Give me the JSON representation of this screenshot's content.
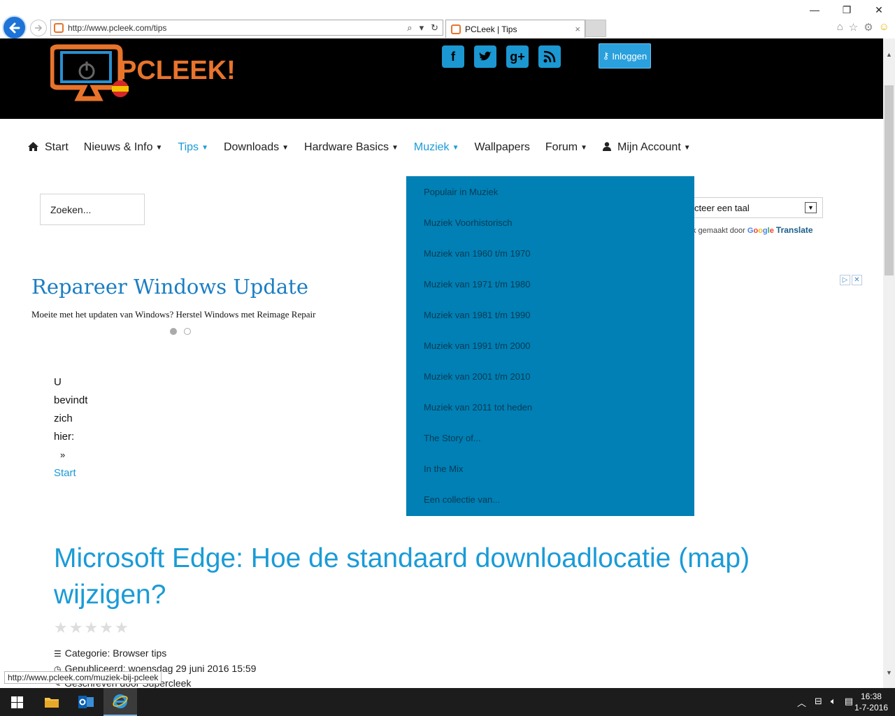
{
  "browser": {
    "address_url": "http://www.pcleek.com/tips",
    "tab_title": "PCLeek | Tips",
    "tab_close": "×",
    "status_url": "http://www.pcleek.com/muziek-bij-pcleek",
    "window_controls": {
      "minimize": "—",
      "restore": "❐",
      "close": "✕"
    },
    "toolbar_icons": {
      "home": "⌂",
      "favorites": "☆",
      "settings": "⚙",
      "feedback": "☺"
    }
  },
  "header": {
    "logo_text": "PCLEEK!",
    "login_label": "Inloggen",
    "social_icons": [
      "facebook-icon",
      "twitter-icon",
      "googleplus-icon",
      "rss-icon"
    ]
  },
  "nav": {
    "items": [
      {
        "label": "Start",
        "icon": "home-icon",
        "active": false,
        "has_menu": false
      },
      {
        "label": "Nieuws & Info",
        "active": false,
        "has_menu": true
      },
      {
        "label": "Tips",
        "active": true,
        "has_menu": true
      },
      {
        "label": "Downloads",
        "active": false,
        "has_menu": true
      },
      {
        "label": "Hardware Basics",
        "active": false,
        "has_menu": true
      },
      {
        "label": "Muziek",
        "active": true,
        "has_menu": true
      },
      {
        "label": "Wallpapers",
        "active": false,
        "has_menu": false
      },
      {
        "label": "Forum",
        "active": false,
        "has_menu": true
      },
      {
        "label": "Mijn Account",
        "icon": "user-icon",
        "active": false,
        "has_menu": true
      }
    ]
  },
  "search": {
    "placeholder": "Zoeken..."
  },
  "translate": {
    "select_label": "cteer een taal",
    "credit_prefix": "k gemaakt door",
    "credit_brand": "Google",
    "credit_link": "Translate"
  },
  "ad": {
    "title": "Repareer Windows Update",
    "text": "Moeite met het updaten van Windows? Herstel Windows met Reimage Repair",
    "choices": [
      "▷",
      "✕"
    ]
  },
  "breadcrumb": {
    "words": [
      "U",
      "bevindt",
      "zich",
      "hier:"
    ],
    "separator": "»",
    "link": "Start"
  },
  "dropdown": {
    "items": [
      "Populair in Muziek",
      "Muziek Voorhistorisch",
      "Muziek van 1960 t/m 1970",
      "Muziek van 1971 t/m 1980",
      "Muziek van 1981 t/m 1990",
      "Muziek van 1991 t/m 2000",
      "Muziek van 2001 t/m 2010",
      "Muziek van 2011 tot heden",
      "The Story of...",
      "In the Mix",
      "Een collectie van..."
    ]
  },
  "article": {
    "title": "Microsoft Edge: Hoe de standaard downloadlocatie (map) wijzigen?",
    "rating_stars": 5,
    "category": "Categorie: Browser tips",
    "published": "Gepubliceerd: woensdag 29 juni 2016 15:59",
    "author": "Geschreven door Supercleek"
  },
  "taskbar": {
    "time": "16:38",
    "date": "1-7-2016"
  },
  "colors": {
    "accent": "#1a9bd7",
    "dropdown_bg": "#0080b4",
    "header_bg": "#000000",
    "logo_orange": "#e8742c"
  }
}
